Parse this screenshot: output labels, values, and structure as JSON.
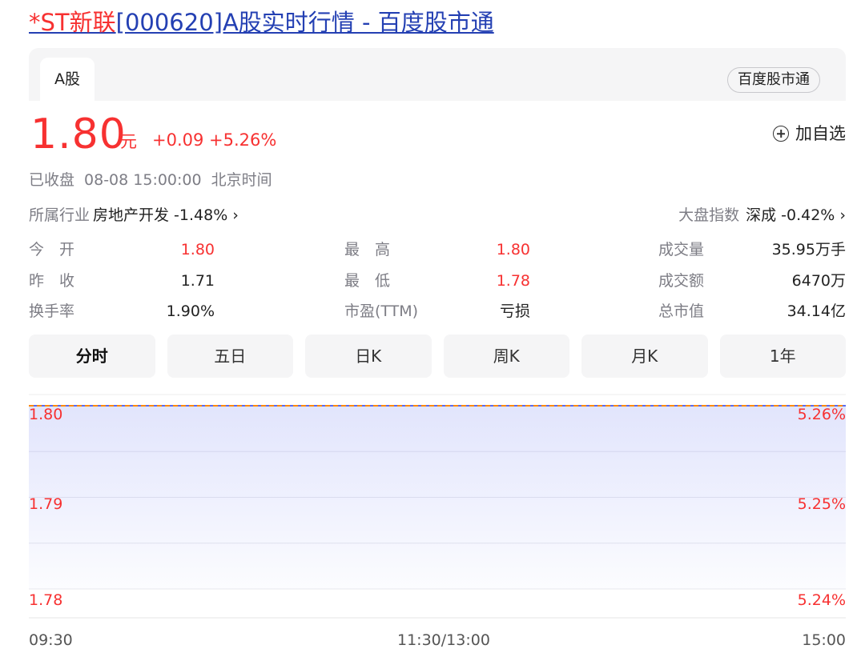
{
  "page": {
    "title_prefix": "*ST新联",
    "title_rest": "[000620]A股实时行情 - 百度股市通"
  },
  "tabs": {
    "a_share": "A股",
    "brand_button": "百度股市通"
  },
  "quote": {
    "price": "1.80",
    "unit": "元",
    "change": "+0.09 +5.26%",
    "add_watch": "加自选",
    "status": "已收盘",
    "datetime": "08-08 15:00:00",
    "timezone": "北京时间"
  },
  "industry": {
    "label": "所属行业",
    "value": "房地产开发 -1.48% ›"
  },
  "market": {
    "label": "大盘指数",
    "value": "深成 -0.42% ›"
  },
  "stats": [
    {
      "label": "今　开",
      "value": "1.80",
      "color": "red"
    },
    {
      "label": "最　高",
      "value": "1.80",
      "color": "red"
    },
    {
      "label": "成交量",
      "value": "35.95万手",
      "color": "black"
    },
    {
      "label": "昨　收",
      "value": "1.71",
      "color": "black"
    },
    {
      "label": "最　低",
      "value": "1.78",
      "color": "red"
    },
    {
      "label": "成交额",
      "value": "6470万",
      "color": "black"
    },
    {
      "label": "换手率",
      "value": "1.90%",
      "color": "black"
    },
    {
      "label": "市盈(TTM)",
      "value": "亏损",
      "color": "black"
    },
    {
      "label": "总市值",
      "value": "34.14亿",
      "color": "black"
    }
  ],
  "periods": [
    "分时",
    "五日",
    "日K",
    "周K",
    "月K",
    "1年"
  ],
  "active_period": "分时",
  "colors": {
    "up": "#f73131",
    "line": "#ff8a00",
    "area": "#5b6cf0"
  },
  "chart_data": {
    "type": "area",
    "y_left_ticks": [
      "1.80",
      "1.79",
      "1.78"
    ],
    "y_right_ticks": [
      "5.26%",
      "5.25%",
      "5.24%"
    ],
    "x_ticks": [
      "09:30",
      "11:30/13:00",
      "15:00"
    ],
    "series": [
      {
        "x": [
          "09:30",
          "11:30",
          "13:00",
          "15:00"
        ],
        "y": [
          1.8,
          1.8,
          1.8,
          1.8
        ]
      }
    ],
    "ylim": [
      1.78,
      1.8
    ]
  }
}
